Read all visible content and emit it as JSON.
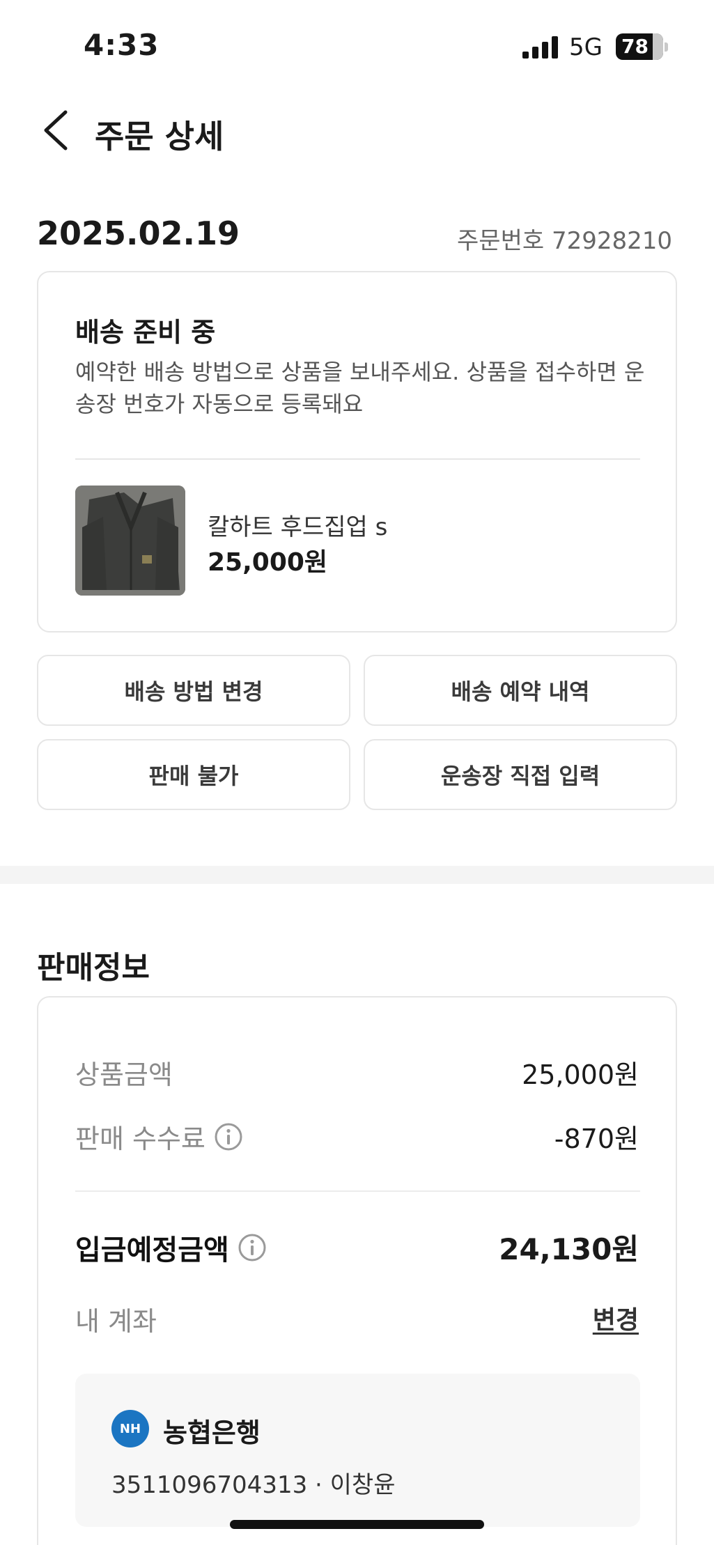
{
  "status_bar": {
    "time": "4:33",
    "network": "5G",
    "battery": "78",
    "battery_level": 0.78
  },
  "header": {
    "title": "주문 상세"
  },
  "order": {
    "date": "2025.02.19",
    "number": "주문번호 72928210"
  },
  "status_card": {
    "title": "배송 준비 중",
    "description": "예약한 배송 방법으로 상품을 보내주세요. 상품을 접수하면 운송장 번호가 자동으로 등록돼요",
    "product": {
      "name": "칼하트 후드집업 s",
      "price": "25,000원"
    }
  },
  "actions": {
    "change_shipping": "배송 방법 변경",
    "shipping_reservation": "배송 예약 내역",
    "not_for_sale": "판매 불가",
    "enter_tracking": "운송장 직접 입력"
  },
  "sales_info": {
    "title": "판매정보",
    "product_amount_label": "상품금액",
    "product_amount": "25,000원",
    "fee_label": "판매 수수료",
    "fee": "-870원",
    "expected_deposit_label": "입금예정금액",
    "expected_deposit": "24,130원",
    "my_account_label": "내 계좌",
    "change_label": "변경",
    "bank": {
      "logo_text": "NH",
      "name": "농협은행",
      "account": "3511096704313 · 이창윤",
      "brand_color": "#1b75c2"
    }
  },
  "icons": [
    "back-icon",
    "signal-icon",
    "info-icon"
  ]
}
